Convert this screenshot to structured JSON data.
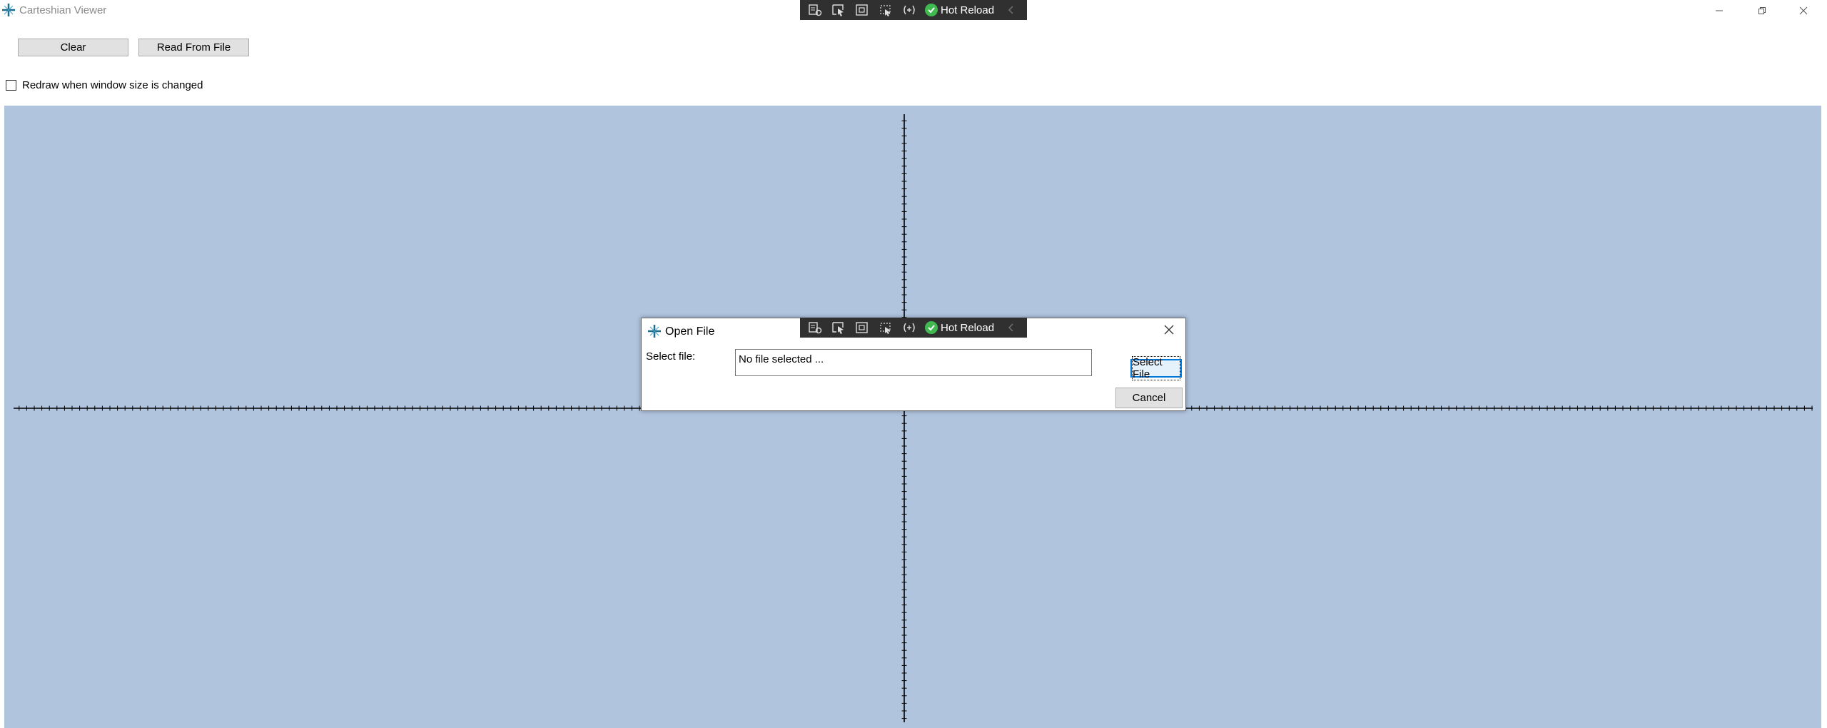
{
  "window": {
    "title": "Carteshian Viewer",
    "controls": [
      "minimize-icon",
      "restore-icon",
      "close-icon"
    ]
  },
  "dev_toolbar": {
    "icons": [
      "live-visual-tree-icon",
      "select-element-icon",
      "display-layout-adorners-icon",
      "track-focus-icon",
      "binding-failures-icon",
      "hot-reload-check-icon",
      "collapse-toolbar-icon"
    ],
    "hot_reload_label": "Hot Reload"
  },
  "toolbar": {
    "clear_label": "Clear",
    "read_from_file_label": "Read From File"
  },
  "options": {
    "redraw_label": "Redraw when window size is changed",
    "redraw_checked": false
  },
  "canvas": {
    "background": "#b0c4de",
    "axis_color": "#000000"
  },
  "dialog": {
    "title": "Open File",
    "select_label": "Select file:",
    "file_placeholder": "No file selected ...",
    "select_file_label": "Select File",
    "cancel_label": "Cancel"
  },
  "colors": {
    "toolbar_dark": "#303030",
    "hot_reload_green": "#3fb950",
    "focus_blue": "#0078d7",
    "button_gray": "#e1e1e1"
  }
}
